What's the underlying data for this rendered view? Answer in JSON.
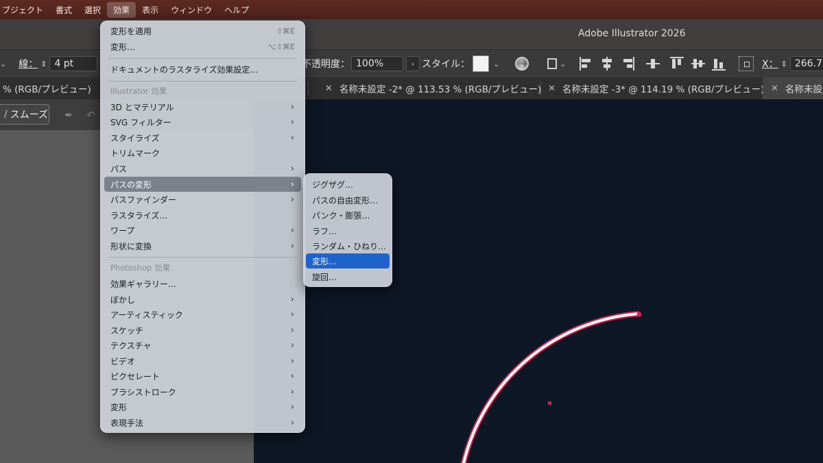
{
  "menubar": {
    "items": [
      "ブジェクト",
      "書式",
      "選択",
      "効果",
      "表示",
      "ウィンドウ",
      "ヘルプ"
    ],
    "active": "効果"
  },
  "window": {
    "title": "Adobe Illustrator 2026"
  },
  "controlbar": {
    "stroke_label": "線：",
    "stroke_value": "4 pt",
    "opacity_label": "不透明度：",
    "opacity_value": "100%",
    "style_label": "スタイル：",
    "x_label": "X：",
    "x_value": "266.7"
  },
  "tabs": [
    {
      "label": "% (RGB/プレビュー)",
      "active": false
    },
    {
      "label": "名称未設定 -2* @ 113.53 % (RGB/プレビュー)",
      "active": false
    },
    {
      "label": "名称未設定 -3* @ 114.19 % (RGB/プレビュー)",
      "active": false
    },
    {
      "label": "名称未設定",
      "active": true
    }
  ],
  "toolbar": {
    "smooth_label": "スムーズ"
  },
  "effect_menu": {
    "apply_label": "変形を適用",
    "apply_shortcut": "⇧⌘E",
    "transform_label": "変形…",
    "transform_shortcut": "⌥⇧⌘E",
    "doc_raster_label": "ドキュメントのラスタライズ効果設定…",
    "illustrator_header": "Illustrator 効果",
    "illustrator_items": [
      "3D とマテリアル",
      "SVG フィルター",
      "スタイライズ",
      "トリムマーク",
      "パス",
      "パスの変形",
      "パスファインダー",
      "ラスタライズ…",
      "ワープ",
      "形状に変換"
    ],
    "photoshop_header": "Photoshop 効果",
    "photoshop_items": [
      "効果ギャラリー…",
      "ぼかし",
      "アーティスティック",
      "スケッチ",
      "テクスチャ",
      "ビデオ",
      "ピクセレート",
      "ブラシストローク",
      "変形",
      "表現手法"
    ],
    "highlighted": "パスの変形"
  },
  "submenu": {
    "items": [
      "ジグザグ…",
      "パスの自由変形…",
      "パンク・膨張…",
      "ラフ…",
      "ランダム・ひねり…",
      "変形…",
      "旋回…"
    ],
    "selected": "変形…"
  },
  "colors": {
    "menubar": "#5e2a22",
    "canvas": "#0e1726",
    "selection": "#1f62c9",
    "arc_stroke": "#ffffff",
    "arc_accent": "#e0204a"
  }
}
